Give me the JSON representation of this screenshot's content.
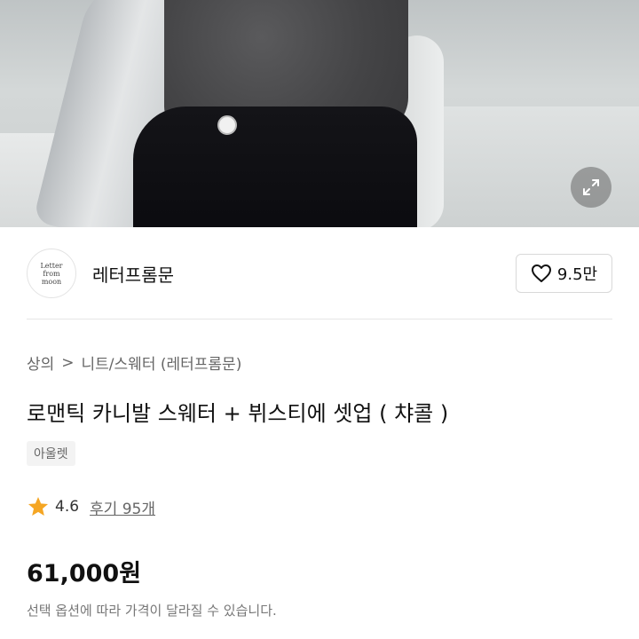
{
  "hero": {
    "image_alt": "product photo",
    "expand_icon": "expand-icon"
  },
  "brand": {
    "logo_line1": "Letter",
    "logo_line2": "from",
    "logo_line3": "moon",
    "name": "레터프롬문",
    "like_icon": "heart-outline-icon",
    "like_count": "9.5만"
  },
  "breadcrumb": {
    "level1": "상의",
    "separator": ">",
    "level2": "니트/스웨터 (레터프롬문)"
  },
  "product": {
    "title": "로맨틱 카니발 스웨터 + 뷔스티에 셋업 ( 챠콜 )",
    "tag": "아울렛",
    "rating": "4.6",
    "review_label": "후기 95개",
    "price": "61,000원",
    "price_note": "선택 옵션에 따라 가격이 달라질 수 있습니다."
  },
  "colors": {
    "star": "#F5A623",
    "text_primary": "#111111",
    "text_secondary": "#666666"
  }
}
